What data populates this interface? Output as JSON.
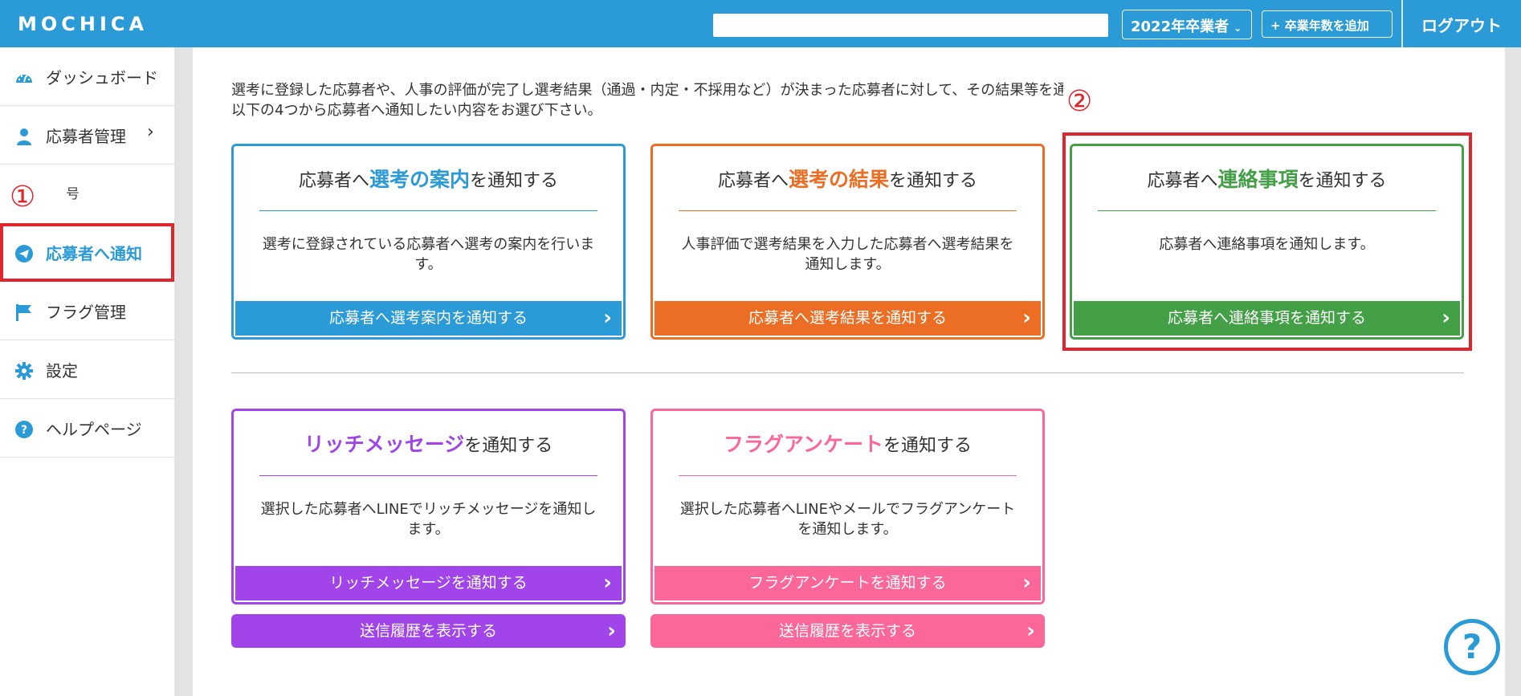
{
  "header": {
    "logo": "MOCHICA",
    "search_value": "",
    "year_select": "2022年卒業者",
    "add_year": "+ 卒業年数を追加",
    "logout": "ログアウト"
  },
  "sidebar": {
    "items": [
      {
        "label": "ダッシュボード"
      },
      {
        "label": "応募者管理"
      },
      {
        "label": "号"
      },
      {
        "label": "応募者へ通知"
      },
      {
        "label": "フラグ管理"
      },
      {
        "label": "設定"
      },
      {
        "label": "ヘルプページ"
      }
    ]
  },
  "annotations": {
    "one": "①",
    "two": "②"
  },
  "main": {
    "intro_line1": "選考に登録した応募者や、人事の評価が完了し選考結果（通過・内定・不採用など）が決まった応募者に対して、その結果等を通知します。",
    "intro_line2": "以下の4つから応募者へ通知したい内容をお選び下さい。",
    "cards": [
      {
        "prefix": "応募者へ",
        "emph": "選考の案内",
        "suffix": "を通知する",
        "desc": "選考に登録されている応募者へ選考の案内を行います。",
        "cta": "応募者へ選考案内を通知する"
      },
      {
        "prefix": "応募者へ",
        "emph": "選考の結果",
        "suffix": "を通知する",
        "desc": "人事評価で選考結果を入力した応募者へ選考結果を通知します。",
        "cta": "応募者へ選考結果を通知する"
      },
      {
        "prefix": "応募者へ",
        "emph": "連絡事項",
        "suffix": "を通知する",
        "desc": "応募者へ連絡事項を通知します。",
        "cta": "応募者へ連絡事項を通知する"
      },
      {
        "prefix": "",
        "emph": "リッチメッセージ",
        "suffix": "を通知する",
        "desc": "選択した応募者へLINEでリッチメッセージを通知します。",
        "cta": "リッチメッセージを通知する",
        "history": "送信履歴を表示する"
      },
      {
        "prefix": "",
        "emph": "フラグアンケート",
        "suffix": "を通知する",
        "desc": "選択した応募者へLINEやメールでフラグアンケートを通知します。",
        "cta": "フラグアンケートを通知する",
        "history": "送信履歴を表示する"
      }
    ]
  },
  "help_button": "?",
  "colors": {
    "header": "#2a9bd6",
    "blue": "#2a9bd6",
    "orange": "#ec6e24",
    "green": "#43a047",
    "purple": "#a144ea",
    "pink": "#fb6798",
    "annotation_red": "#e0252c"
  }
}
